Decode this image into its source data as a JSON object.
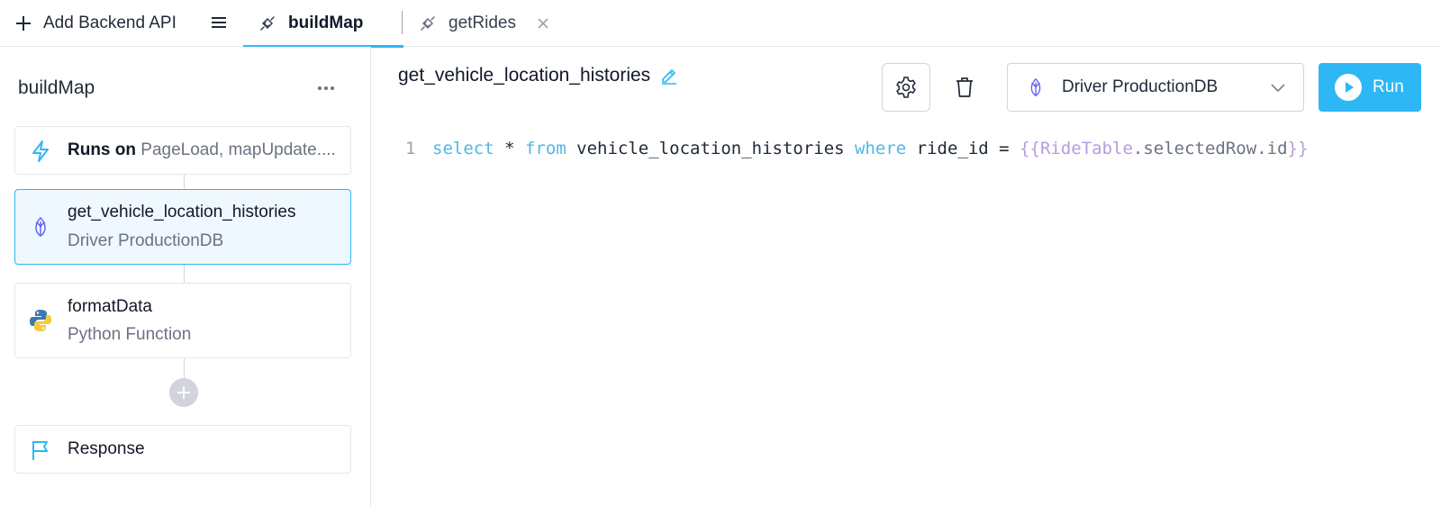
{
  "topbar": {
    "add_label": "Add Backend API",
    "tabs": [
      {
        "label": "buildMap",
        "active": true
      },
      {
        "label": "getRides",
        "active": false
      }
    ]
  },
  "sidebar": {
    "title": "buildMap",
    "runs_on": {
      "label": "Runs on",
      "value": "PageLoad, mapUpdate...."
    },
    "steps": [
      {
        "name": "get_vehicle_location_histories",
        "subtitle": "Driver ProductionDB",
        "icon": "cockroachdb-icon",
        "selected": true
      },
      {
        "name": "formatData",
        "subtitle": "Python Function",
        "icon": "python-icon",
        "selected": false
      }
    ],
    "response_label": "Response"
  },
  "editor": {
    "query_name": "get_vehicle_location_histories",
    "resource": "Driver ProductionDB",
    "run_label": "Run",
    "line_number": "1",
    "tokens": {
      "select": "select",
      "star": " * ",
      "from": "from",
      "table": " vehicle_location_histories ",
      "where": "where",
      "cond": " ride_id = ",
      "open": "{{",
      "binding_obj": "RideTable",
      "binding_rest": ".selectedRow.id",
      "close": "}}"
    }
  },
  "colors": {
    "accent": "#2eb7f5",
    "keyword": "#4fb8e6",
    "template": "#b69de0",
    "selected_bg": "#eff8fe"
  }
}
